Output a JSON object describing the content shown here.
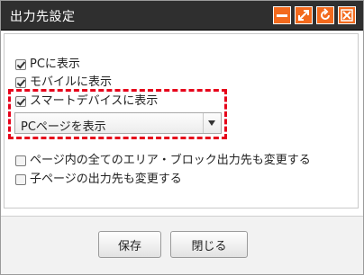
{
  "window": {
    "title": "出力先設定",
    "controls": [
      {
        "name": "minimize-icon"
      },
      {
        "name": "maximize-icon"
      },
      {
        "name": "refresh-icon"
      },
      {
        "name": "close-icon"
      }
    ],
    "accent_color": "#f36a1d"
  },
  "options": {
    "pc": {
      "label": "PCに表示",
      "checked": true
    },
    "mobile": {
      "label": "モバイルに表示",
      "checked": true
    },
    "smart": {
      "label": "スマートデバイスに表示",
      "checked": true
    },
    "smart_select": {
      "value": "PCページを表示"
    },
    "all_areas": {
      "label": "ページ内の全てのエリア・ブロック出力先も変更する",
      "checked": false
    },
    "child_pages": {
      "label": "子ページの出力先も変更する",
      "checked": false
    }
  },
  "footer": {
    "save_label": "保存",
    "close_label": "閉じる"
  },
  "highlight_color": "#e6001a"
}
